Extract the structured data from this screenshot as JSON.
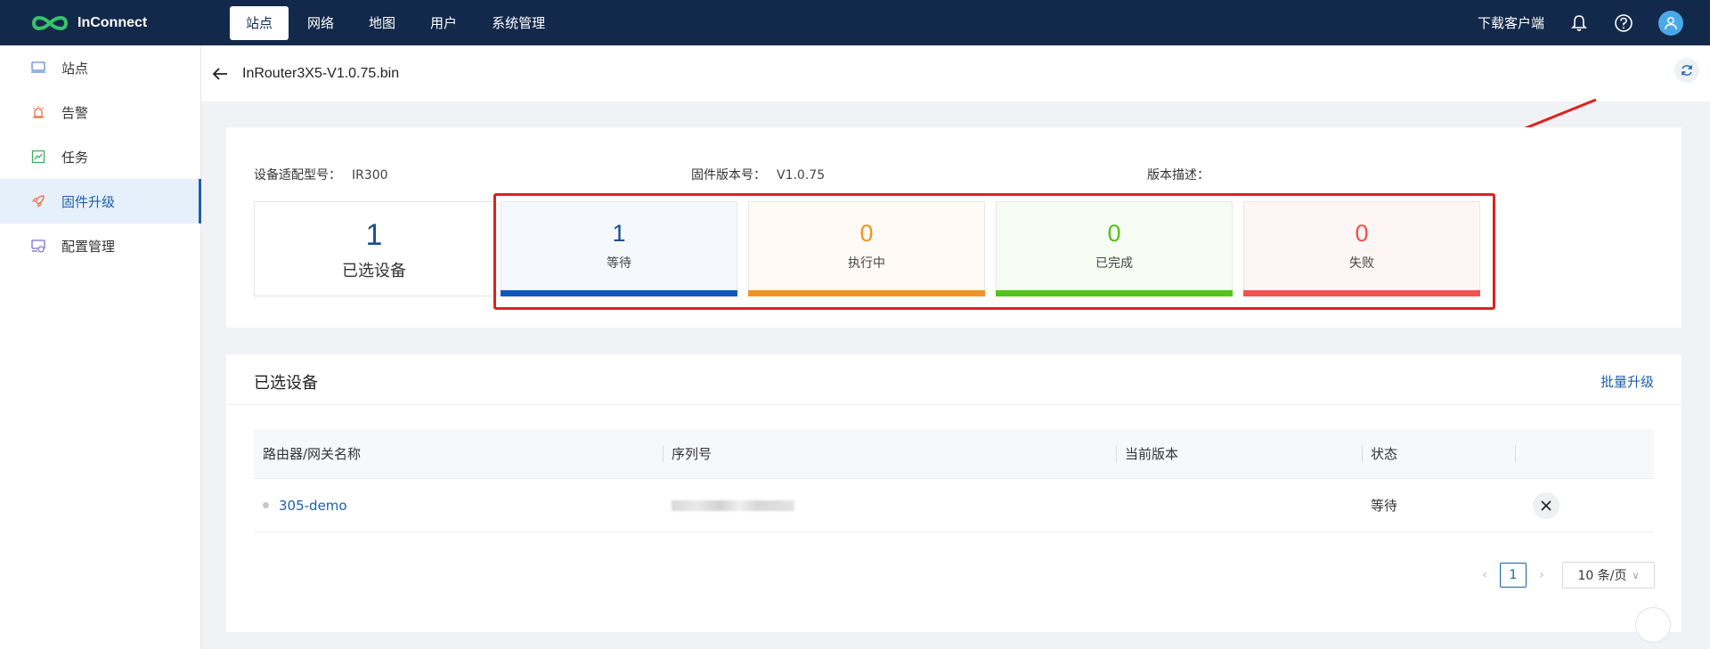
{
  "brand": {
    "name": "InConnect"
  },
  "nav": {
    "items": [
      {
        "label": "站点",
        "active": true
      },
      {
        "label": "网络",
        "active": false
      },
      {
        "label": "地图",
        "active": false
      },
      {
        "label": "用户",
        "active": false
      },
      {
        "label": "系统管理",
        "active": false
      }
    ],
    "download_label": "下载客户端"
  },
  "sidebar": {
    "items": [
      {
        "label": "站点",
        "icon": "screen-icon"
      },
      {
        "label": "告警",
        "icon": "alarm-icon"
      },
      {
        "label": "任务",
        "icon": "chart-icon"
      },
      {
        "label": "固件升级",
        "icon": "rocket-icon",
        "active": true
      },
      {
        "label": "配置管理",
        "icon": "config-icon"
      }
    ]
  },
  "header": {
    "title": "InRouter3X5-V1.0.75.bin"
  },
  "info": {
    "model_label": "设备适配型号：",
    "model_value": "IR300",
    "version_label": "固件版本号：",
    "version_value": "V1.0.75",
    "desc_label": "版本描述："
  },
  "selected": {
    "count": "1",
    "label": "已选设备"
  },
  "stats": [
    {
      "value": "1",
      "label": "等待",
      "color": "#0f56c4",
      "bg": "#f5f9fe",
      "text_color": "#1b4f94"
    },
    {
      "value": "0",
      "label": "执行中",
      "color": "#f29423",
      "bg": "#fffaf5",
      "text_color": "#f29423"
    },
    {
      "value": "0",
      "label": "已完成",
      "color": "#52c41a",
      "bg": "#f6fbf4",
      "text_color": "#52c41a"
    },
    {
      "value": "0",
      "label": "失败",
      "color": "#f5504f",
      "bg": "#fef5f5",
      "text_color": "#f5504f"
    }
  ],
  "devices": {
    "title": "已选设备",
    "batch_label": "批量升级",
    "columns": [
      "路由器/网关名称",
      "序列号",
      "当前版本",
      "状态"
    ],
    "rows": [
      {
        "name": "305-demo",
        "serial": "",
        "version": "",
        "status": "等待"
      }
    ]
  },
  "pager": {
    "current": "1",
    "page_size": "10 条/页"
  },
  "colors": {
    "topbar": "#13294b",
    "accent": "#1b5fae",
    "highlight": "#e0211d"
  }
}
